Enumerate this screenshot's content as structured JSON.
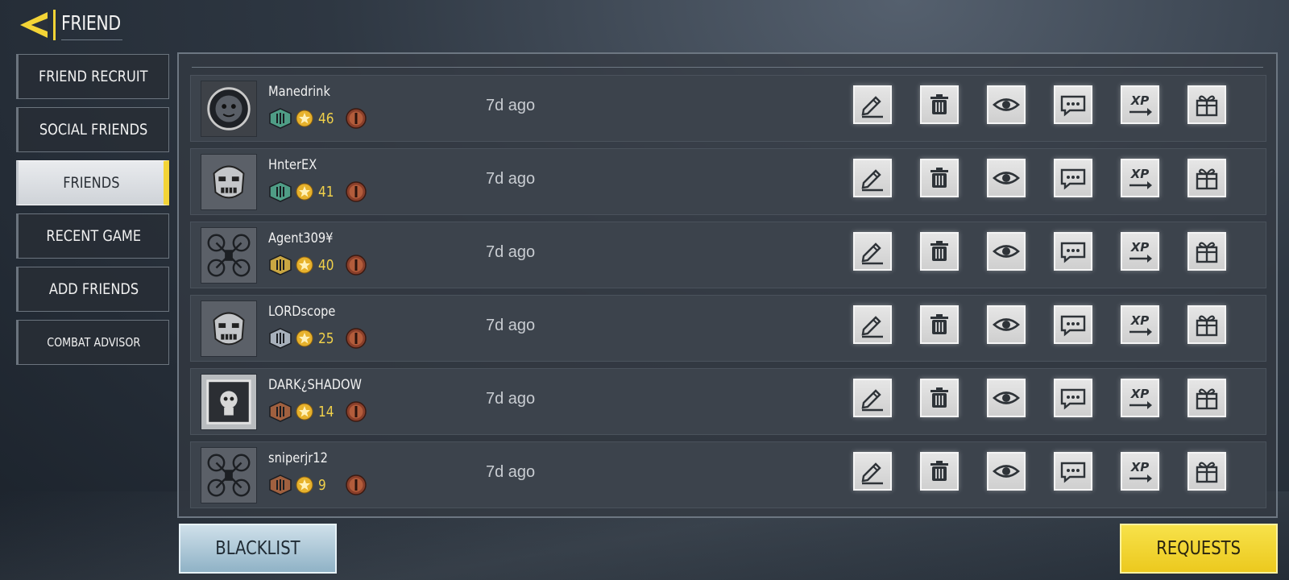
{
  "header": {
    "title": "FRIEND",
    "back_icon": "back-arrow-icon",
    "accent_color": "#f3d436"
  },
  "sidebar": {
    "tabs": [
      {
        "label": "FRIEND RECRUIT",
        "active": false
      },
      {
        "label": "SOCIAL FRIENDS",
        "active": false
      },
      {
        "label": "FRIENDS",
        "active": true
      },
      {
        "label": "RECENT GAME",
        "active": false
      },
      {
        "label": "ADD FRIENDS",
        "active": false
      },
      {
        "label": "COMBAT ADVISOR",
        "active": false
      }
    ]
  },
  "friends": [
    {
      "name": "Manedrink",
      "rank_icon": "rank-emblem-green-icon",
      "level": "46",
      "last_seen": "7d ago",
      "avatar_icon": "lion-emblem-avatar-icon"
    },
    {
      "name": "HnterEX",
      "rank_icon": "rank-emblem-green-icon",
      "level": "41",
      "last_seen": "7d ago",
      "avatar_icon": "skull-mask-avatar-icon"
    },
    {
      "name": "Agent309¥",
      "rank_icon": "rank-emblem-gold-icon",
      "level": "40",
      "last_seen": "7d ago",
      "avatar_icon": "drone-avatar-icon"
    },
    {
      "name": "LORDscope",
      "rank_icon": "rank-emblem-silver-icon",
      "level": "25",
      "last_seen": "7d ago",
      "avatar_icon": "skull-mask-avatar-icon"
    },
    {
      "name": "DARK¿SHADOW",
      "rank_icon": "rank-emblem-bronze-icon",
      "level": "14",
      "last_seen": "7d ago",
      "avatar_icon": "skull-frame-avatar-icon"
    },
    {
      "name": "sniperjr12",
      "rank_icon": "rank-emblem-bronze-icon",
      "level": "9",
      "last_seen": "7d ago",
      "avatar_icon": "drone-avatar-icon"
    }
  ],
  "row_actions": [
    "edit-icon",
    "delete-icon",
    "view-icon",
    "message-icon",
    "xp-transfer-icon",
    "gift-icon"
  ],
  "footer": {
    "blacklist_label": "BLACKLIST",
    "requests_label": "REQUESTS"
  }
}
